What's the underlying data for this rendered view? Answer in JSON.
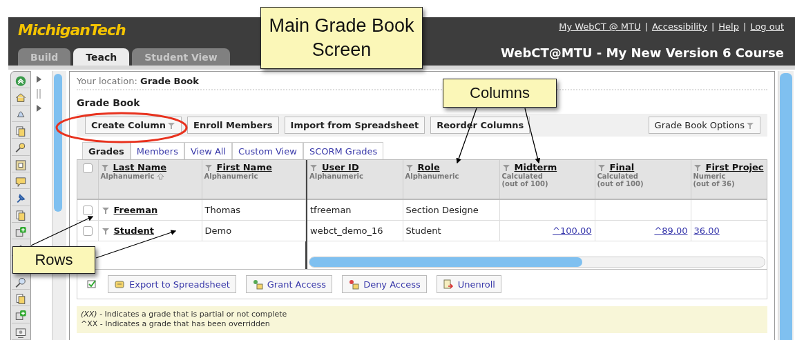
{
  "header": {
    "logo": "MichiganTech",
    "tabs": [
      {
        "label": "Build",
        "selected": false
      },
      {
        "label": "Teach",
        "selected": true
      },
      {
        "label": "Student View",
        "selected": false
      }
    ],
    "links": [
      "My WebCT @ MTU",
      "Accessibility",
      "Help",
      "Log out"
    ],
    "separator": "|",
    "course_title": "WebCT@MTU - My New Version 6 Course"
  },
  "location": {
    "label": "Your location:",
    "value": "Grade Book"
  },
  "heading": "Grade Book",
  "toolbar": {
    "buttons": [
      {
        "label": "Create Column",
        "menu": true
      },
      {
        "label": "Enroll Members",
        "menu": false
      },
      {
        "label": "Import from Spreadsheet",
        "menu": false
      },
      {
        "label": "Reorder Columns",
        "menu": false
      }
    ],
    "options": {
      "label": "Grade Book Options",
      "menu": true
    }
  },
  "subtabs": [
    {
      "label": "Grades",
      "selected": true
    },
    {
      "label": "Members",
      "selected": false
    },
    {
      "label": "View All",
      "selected": false
    },
    {
      "label": "Custom View",
      "selected": false
    },
    {
      "label": "SCORM Grades",
      "selected": false
    }
  ],
  "table": {
    "columns": [
      {
        "name": "Last Name",
        "type": "Alphanumeric",
        "sorted": true,
        "frozen": true
      },
      {
        "name": "First Name",
        "type": "Alphanumeric",
        "sorted": false,
        "frozen": true
      },
      {
        "name": "User ID",
        "type": "Alphanumeric",
        "sorted": false,
        "frozen": false
      },
      {
        "name": "Role",
        "type": "Alphanumeric",
        "sorted": false,
        "frozen": false
      },
      {
        "name": "Midterm",
        "type": "Calculated",
        "out_of": "(out of 100)",
        "sorted": false,
        "frozen": false
      },
      {
        "name": "Final",
        "type": "Calculated",
        "out_of": "(out of 100)",
        "sorted": false,
        "frozen": false
      },
      {
        "name": "First Projec",
        "type": "Numeric",
        "out_of": "(out of 36)",
        "sorted": false,
        "frozen": false
      }
    ],
    "header_checked": false,
    "rows": [
      {
        "checked": false,
        "cells": [
          {
            "text": "Freeman",
            "kind": "menu-link"
          },
          {
            "text": "Thomas",
            "kind": "text"
          },
          {
            "text": "tfreeman",
            "kind": "text"
          },
          {
            "text": "Section Designe",
            "kind": "text"
          },
          {
            "kind": "empty"
          },
          {
            "kind": "empty"
          },
          {
            "kind": "empty"
          }
        ]
      },
      {
        "checked": false,
        "cells": [
          {
            "text": "Student",
            "kind": "menu-link"
          },
          {
            "text": "Demo",
            "kind": "text"
          },
          {
            "text": "webct_demo_16",
            "kind": "text"
          },
          {
            "text": "Student",
            "kind": "text"
          },
          {
            "text": "^100.00",
            "kind": "score"
          },
          {
            "text": "^89.00",
            "kind": "score"
          },
          {
            "text": "36.00",
            "kind": "link"
          }
        ]
      }
    ]
  },
  "actions": [
    {
      "label": "Export to Spreadsheet"
    },
    {
      "label": "Grant Access"
    },
    {
      "label": "Deny Access"
    },
    {
      "label": "Unenroll"
    }
  ],
  "legend": [
    "*(XX)* - Indicates a grade that is partial or not complete",
    "^XX - Indicates a grade that has been overridden"
  ],
  "callouts": [
    {
      "text": "Main Grade Book Screen"
    },
    {
      "text": "Columns"
    },
    {
      "text": "Rows"
    }
  ]
}
